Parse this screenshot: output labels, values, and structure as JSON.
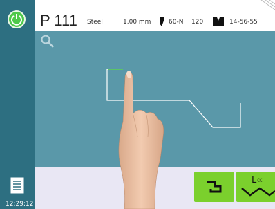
{
  "header": {
    "program": "P 111",
    "material": "Steel",
    "thickness": "1.00 mm",
    "punch": "60-N",
    "punch_value": "120",
    "die": "14-56-55"
  },
  "status": {
    "time": "12:29:12"
  },
  "icons": {
    "power": "power-icon",
    "search": "search-icon",
    "menu": "menu-icon",
    "punch": "punch-icon",
    "die": "die-icon",
    "bend_sequence": "bend-sequence-icon",
    "angle_measure": "angle-measure-icon"
  },
  "colors": {
    "sidebar": "#2d6f81",
    "canvas": "#5a98a9",
    "accent_green": "#7bd02d",
    "profile_line": "#ffffff",
    "active_segment": "#4ec94a"
  }
}
